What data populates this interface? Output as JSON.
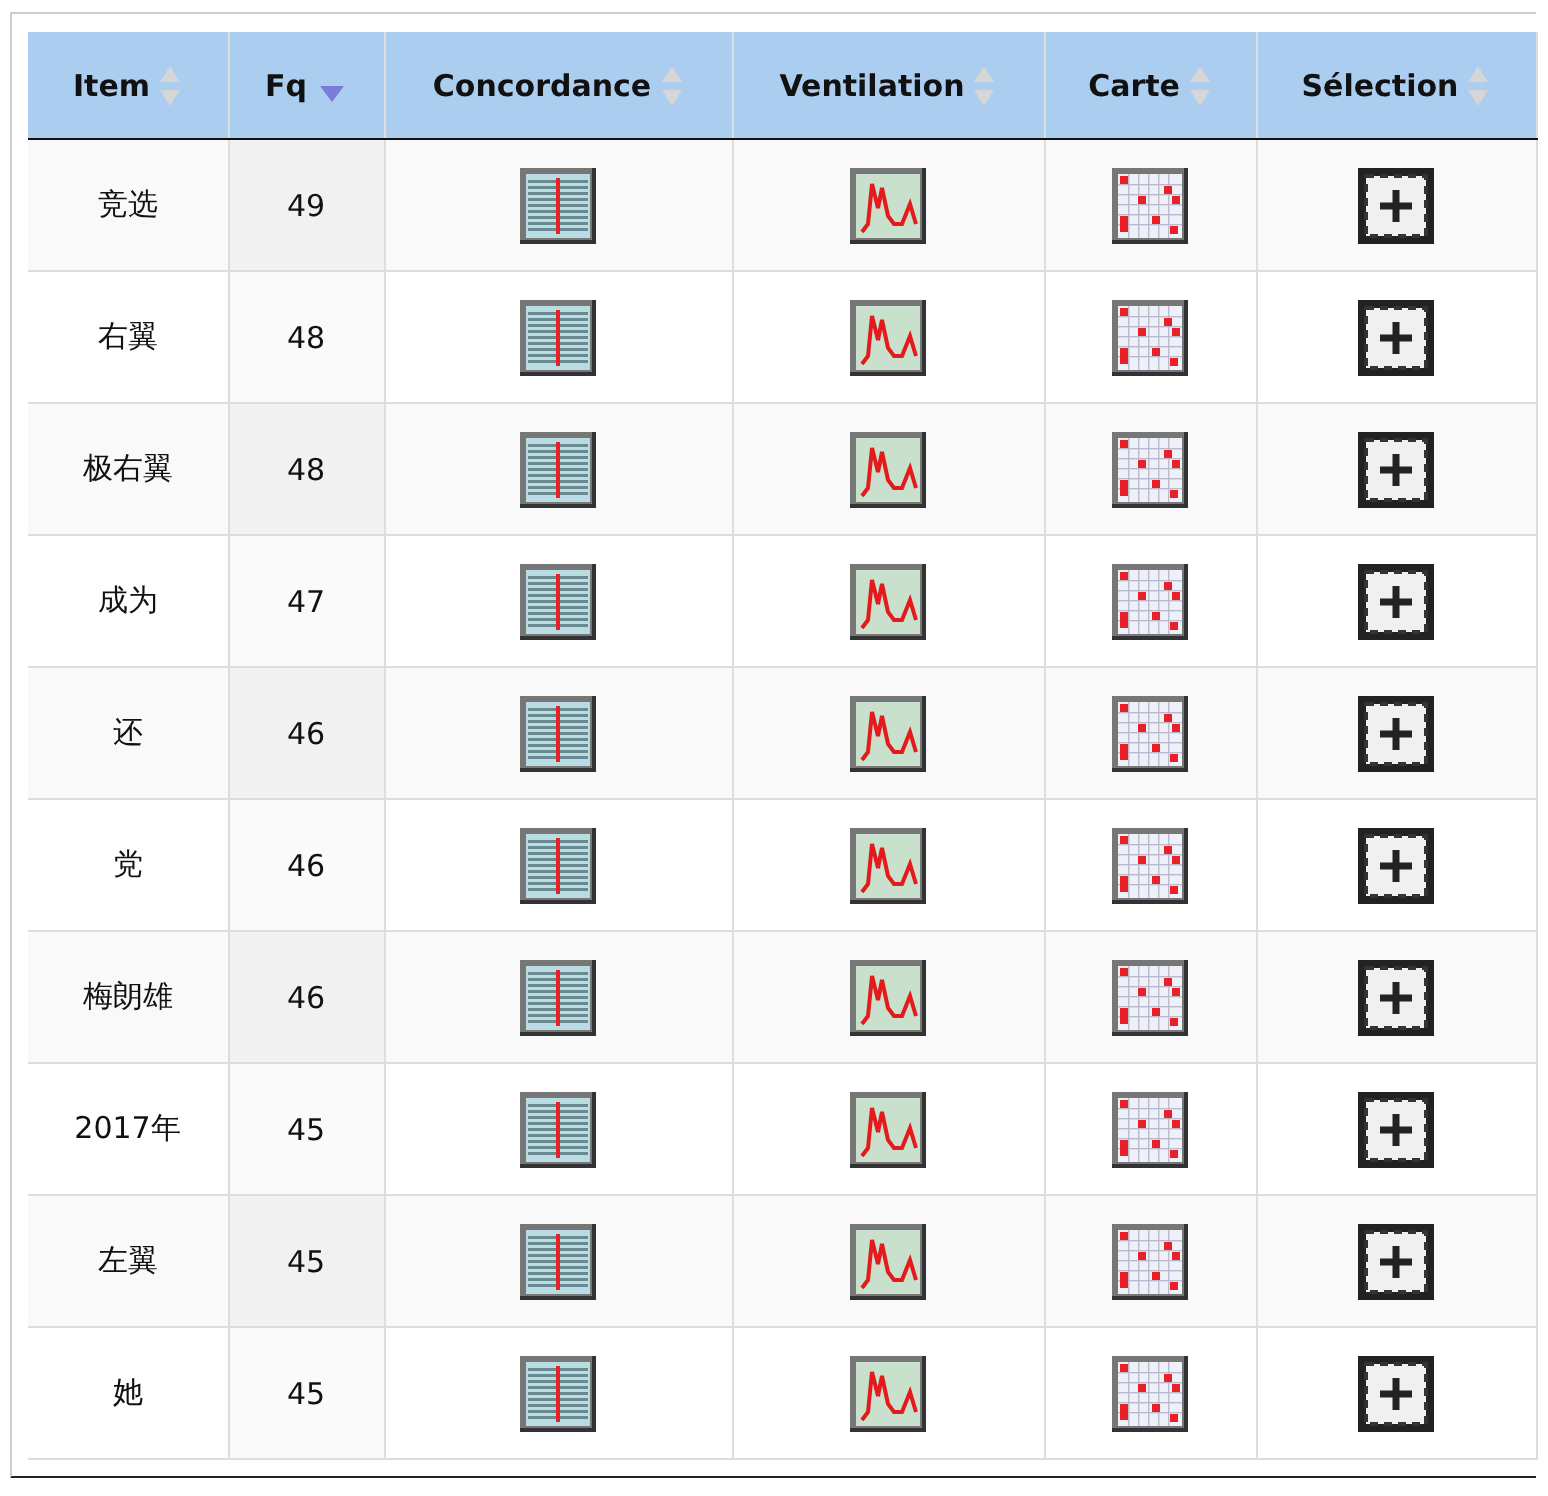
{
  "table": {
    "columns": [
      {
        "label": "Item",
        "kind": "text",
        "sorted": false
      },
      {
        "label": "Fq",
        "kind": "number",
        "sorted": true
      },
      {
        "label": "Concordance",
        "kind": "concordance",
        "sorted": false
      },
      {
        "label": "Ventilation",
        "kind": "ventilation",
        "sorted": false
      },
      {
        "label": "Carte",
        "kind": "map",
        "sorted": false
      },
      {
        "label": "Sélection",
        "kind": "select",
        "sorted": false
      }
    ],
    "rows": [
      {
        "item": "竞选",
        "fq": "49"
      },
      {
        "item": "右翼",
        "fq": "48"
      },
      {
        "item": "极右翼",
        "fq": "48"
      },
      {
        "item": "成为",
        "fq": "47"
      },
      {
        "item": "还",
        "fq": "46"
      },
      {
        "item": "党",
        "fq": "46"
      },
      {
        "item": "梅朗雄",
        "fq": "46"
      },
      {
        "item": "2017年",
        "fq": "45"
      },
      {
        "item": "左翼",
        "fq": "45"
      },
      {
        "item": "她",
        "fq": "45"
      }
    ]
  }
}
